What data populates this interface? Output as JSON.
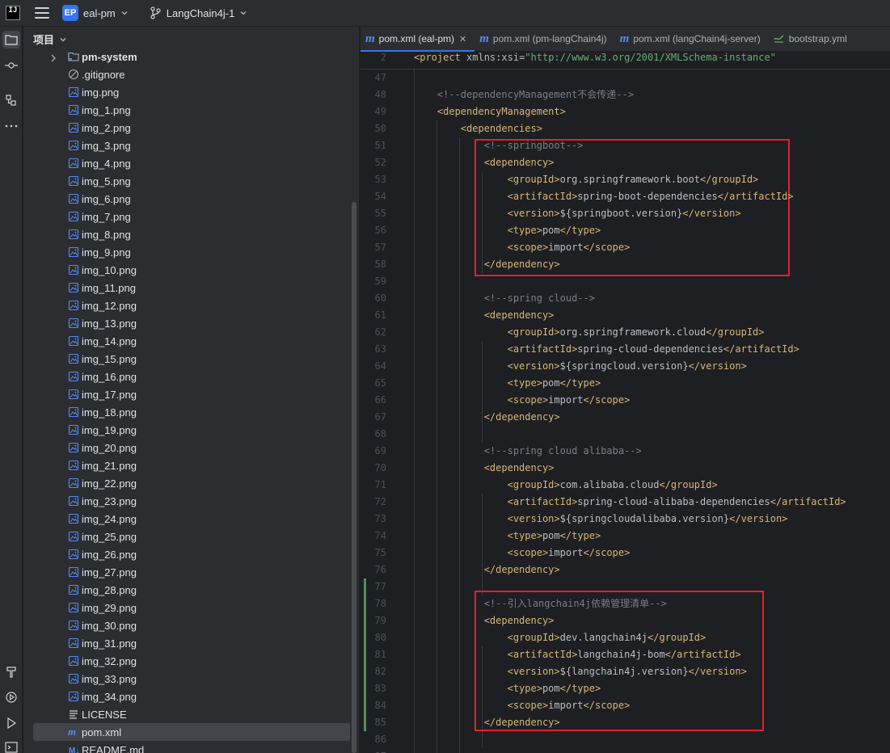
{
  "titlebar": {
    "app_logo": "IJ",
    "project_badge": "EP",
    "project_name": "eal-pm",
    "branch_name": "LangChain4j-1"
  },
  "activity_bar": {
    "items": [
      "project-icon",
      "commit-icon",
      "structure-icon",
      "more-icon",
      "build-icon",
      "services-icon",
      "run-icon",
      "terminal-icon"
    ]
  },
  "project_panel": {
    "title": "项目",
    "tree": [
      {
        "label": "pm-system",
        "type": "folder"
      },
      {
        "label": ".gitignore",
        "type": "ignore"
      },
      {
        "label": "img.png",
        "type": "image"
      },
      {
        "label": "img_1.png",
        "type": "image"
      },
      {
        "label": "img_2.png",
        "type": "image"
      },
      {
        "label": "img_3.png",
        "type": "image"
      },
      {
        "label": "img_4.png",
        "type": "image"
      },
      {
        "label": "img_5.png",
        "type": "image"
      },
      {
        "label": "img_6.png",
        "type": "image"
      },
      {
        "label": "img_7.png",
        "type": "image"
      },
      {
        "label": "img_8.png",
        "type": "image"
      },
      {
        "label": "img_9.png",
        "type": "image"
      },
      {
        "label": "img_10.png",
        "type": "image"
      },
      {
        "label": "img_11.png",
        "type": "image"
      },
      {
        "label": "img_12.png",
        "type": "image"
      },
      {
        "label": "img_13.png",
        "type": "image"
      },
      {
        "label": "img_14.png",
        "type": "image"
      },
      {
        "label": "img_15.png",
        "type": "image"
      },
      {
        "label": "img_16.png",
        "type": "image"
      },
      {
        "label": "img_17.png",
        "type": "image"
      },
      {
        "label": "img_18.png",
        "type": "image"
      },
      {
        "label": "img_19.png",
        "type": "image"
      },
      {
        "label": "img_20.png",
        "type": "image"
      },
      {
        "label": "img_21.png",
        "type": "image"
      },
      {
        "label": "img_22.png",
        "type": "image"
      },
      {
        "label": "img_23.png",
        "type": "image"
      },
      {
        "label": "img_24.png",
        "type": "image"
      },
      {
        "label": "img_25.png",
        "type": "image"
      },
      {
        "label": "img_26.png",
        "type": "image"
      },
      {
        "label": "img_27.png",
        "type": "image"
      },
      {
        "label": "img_28.png",
        "type": "image"
      },
      {
        "label": "img_29.png",
        "type": "image"
      },
      {
        "label": "img_30.png",
        "type": "image"
      },
      {
        "label": "img_31.png",
        "type": "image"
      },
      {
        "label": "img_32.png",
        "type": "image"
      },
      {
        "label": "img_33.png",
        "type": "image"
      },
      {
        "label": "img_34.png",
        "type": "image"
      },
      {
        "label": "LICENSE",
        "type": "text"
      },
      {
        "label": "pom.xml",
        "type": "maven",
        "selected": true
      },
      {
        "label": "README.md",
        "type": "markdown"
      }
    ]
  },
  "editor": {
    "tabs": [
      {
        "label": "pom.xml (eal-pm)",
        "icon": "maven-icon",
        "active": true,
        "closable": true
      },
      {
        "label": "pom.xml (pm-langChain4j)",
        "icon": "maven-icon",
        "active": false
      },
      {
        "label": "pom.xml (langChain4j-server)",
        "icon": "maven-icon",
        "active": false
      },
      {
        "label": "bootstrap.yml",
        "icon": "yaml-icon",
        "active": false
      }
    ],
    "sticky_line": {
      "number": "2",
      "segments": [
        {
          "t": "<project ",
          "c": "tag"
        },
        {
          "t": "xmlns:xsi",
          "c": "attr"
        },
        {
          "t": "=",
          "c": "plain"
        },
        {
          "t": "\"http://www.w3.org/2001/XMLSchema-instance\"",
          "c": "val"
        }
      ]
    },
    "lines": [
      {
        "n": "47",
        "s": []
      },
      {
        "n": "48",
        "s": [
          {
            "t": "    <!--dependencyManagement不会传递-->",
            "c": "cmt"
          }
        ]
      },
      {
        "n": "49",
        "s": [
          {
            "t": "    <dependencyManagement>",
            "c": "tag"
          }
        ]
      },
      {
        "n": "50",
        "s": [
          {
            "t": "        <dependencies>",
            "c": "tag"
          }
        ]
      },
      {
        "n": "51",
        "s": [
          {
            "t": "            <!--springboot-->",
            "c": "cmt"
          }
        ]
      },
      {
        "n": "52",
        "s": [
          {
            "t": "            <dependency>",
            "c": "tag"
          }
        ]
      },
      {
        "n": "53",
        "s": [
          {
            "t": "                <groupId>",
            "c": "tag"
          },
          {
            "t": "org.springframework.boot",
            "c": "plain"
          },
          {
            "t": "</groupId>",
            "c": "tag"
          }
        ]
      },
      {
        "n": "54",
        "s": [
          {
            "t": "                <artifactId>",
            "c": "tag"
          },
          {
            "t": "spring-boot-dependencies",
            "c": "plain"
          },
          {
            "t": "</artifactId>",
            "c": "tag"
          }
        ]
      },
      {
        "n": "55",
        "s": [
          {
            "t": "                <version>",
            "c": "tag"
          },
          {
            "t": "${springboot.version}",
            "c": "plain"
          },
          {
            "t": "</version>",
            "c": "tag"
          }
        ]
      },
      {
        "n": "56",
        "s": [
          {
            "t": "                <type>",
            "c": "tag"
          },
          {
            "t": "pom",
            "c": "plain"
          },
          {
            "t": "</type>",
            "c": "tag"
          }
        ]
      },
      {
        "n": "57",
        "s": [
          {
            "t": "                <scope>",
            "c": "tag"
          },
          {
            "t": "import",
            "c": "plain"
          },
          {
            "t": "</scope>",
            "c": "tag"
          }
        ]
      },
      {
        "n": "58",
        "s": [
          {
            "t": "            </dependency>",
            "c": "tag"
          }
        ]
      },
      {
        "n": "59",
        "s": []
      },
      {
        "n": "60",
        "s": [
          {
            "t": "            <!--spring cloud-->",
            "c": "cmt"
          }
        ]
      },
      {
        "n": "61",
        "s": [
          {
            "t": "            <dependency>",
            "c": "tag"
          }
        ]
      },
      {
        "n": "62",
        "s": [
          {
            "t": "                <groupId>",
            "c": "tag"
          },
          {
            "t": "org.springframework.cloud",
            "c": "plain"
          },
          {
            "t": "</groupId>",
            "c": "tag"
          }
        ]
      },
      {
        "n": "63",
        "s": [
          {
            "t": "                <artifactId>",
            "c": "tag"
          },
          {
            "t": "spring-cloud-dependencies",
            "c": "plain"
          },
          {
            "t": "</artifactId>",
            "c": "tag"
          }
        ]
      },
      {
        "n": "64",
        "s": [
          {
            "t": "                <version>",
            "c": "tag"
          },
          {
            "t": "${springcloud.version}",
            "c": "plain"
          },
          {
            "t": "</version>",
            "c": "tag"
          }
        ]
      },
      {
        "n": "65",
        "s": [
          {
            "t": "                <type>",
            "c": "tag"
          },
          {
            "t": "pom",
            "c": "plain"
          },
          {
            "t": "</type>",
            "c": "tag"
          }
        ]
      },
      {
        "n": "66",
        "s": [
          {
            "t": "                <scope>",
            "c": "tag"
          },
          {
            "t": "import",
            "c": "plain"
          },
          {
            "t": "</scope>",
            "c": "tag"
          }
        ]
      },
      {
        "n": "67",
        "s": [
          {
            "t": "            </dependency>",
            "c": "tag"
          }
        ]
      },
      {
        "n": "68",
        "s": []
      },
      {
        "n": "69",
        "s": [
          {
            "t": "            <!--spring cloud alibaba-->",
            "c": "cmt"
          }
        ]
      },
      {
        "n": "70",
        "s": [
          {
            "t": "            <dependency>",
            "c": "tag"
          }
        ]
      },
      {
        "n": "71",
        "s": [
          {
            "t": "                <groupId>",
            "c": "tag"
          },
          {
            "t": "com.alibaba.cloud",
            "c": "plain"
          },
          {
            "t": "</groupId>",
            "c": "tag"
          }
        ]
      },
      {
        "n": "72",
        "s": [
          {
            "t": "                <artifactId>",
            "c": "tag"
          },
          {
            "t": "spring-cloud-alibaba-dependencies",
            "c": "plain"
          },
          {
            "t": "</artifactId>",
            "c": "tag"
          }
        ]
      },
      {
        "n": "73",
        "s": [
          {
            "t": "                <version>",
            "c": "tag"
          },
          {
            "t": "${springcloudalibaba.version}",
            "c": "plain"
          },
          {
            "t": "</version>",
            "c": "tag"
          }
        ]
      },
      {
        "n": "74",
        "s": [
          {
            "t": "                <type>",
            "c": "tag"
          },
          {
            "t": "pom",
            "c": "plain"
          },
          {
            "t": "</type>",
            "c": "tag"
          }
        ]
      },
      {
        "n": "75",
        "s": [
          {
            "t": "                <scope>",
            "c": "tag"
          },
          {
            "t": "import",
            "c": "plain"
          },
          {
            "t": "</scope>",
            "c": "tag"
          }
        ]
      },
      {
        "n": "76",
        "s": [
          {
            "t": "            </dependency>",
            "c": "tag"
          }
        ]
      },
      {
        "n": "77",
        "s": []
      },
      {
        "n": "78",
        "s": [
          {
            "t": "            <!--引入langchain4j依赖管理清单-->",
            "c": "cmt"
          }
        ]
      },
      {
        "n": "79",
        "s": [
          {
            "t": "            <dependency>",
            "c": "tag"
          }
        ]
      },
      {
        "n": "80",
        "s": [
          {
            "t": "                <groupId>",
            "c": "tag"
          },
          {
            "t": "dev.langchain4j",
            "c": "plain"
          },
          {
            "t": "</groupId>",
            "c": "tag"
          }
        ]
      },
      {
        "n": "81",
        "s": [
          {
            "t": "                <artifactId>",
            "c": "tag"
          },
          {
            "t": "langchain4j-bom",
            "c": "plain"
          },
          {
            "t": "</artifactId>",
            "c": "tag"
          }
        ]
      },
      {
        "n": "82",
        "s": [
          {
            "t": "                <version>",
            "c": "tag"
          },
          {
            "t": "${langchain4j.version}",
            "c": "plain"
          },
          {
            "t": "</version>",
            "c": "tag"
          }
        ]
      },
      {
        "n": "83",
        "s": [
          {
            "t": "                <type>",
            "c": "tag"
          },
          {
            "t": "pom",
            "c": "plain"
          },
          {
            "t": "</type>",
            "c": "tag"
          }
        ]
      },
      {
        "n": "84",
        "s": [
          {
            "t": "                <scope>",
            "c": "tag"
          },
          {
            "t": "import",
            "c": "plain"
          },
          {
            "t": "</scope>",
            "c": "tag"
          }
        ]
      },
      {
        "n": "85",
        "s": [
          {
            "t": "            </dependency>",
            "c": "tag"
          }
        ]
      },
      {
        "n": "86",
        "s": []
      },
      {
        "n": "87",
        "s": []
      }
    ],
    "colors": {
      "tag": "#d5b778",
      "attr": "#bababa",
      "value": "#6aab73",
      "comment": "#7a7e85",
      "text": "#bcbec4",
      "highlight_box": "#e3202a",
      "vcs_added": "#549159",
      "accent": "#3574f0"
    }
  }
}
